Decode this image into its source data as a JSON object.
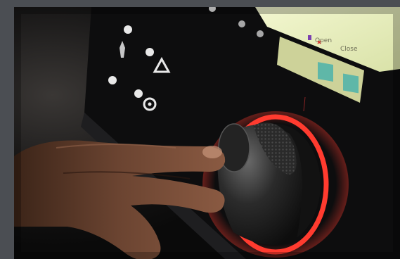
{
  "photo": {
    "subject": "hand-turning-control-knob",
    "ring_color": "#ff3b2f",
    "screen_color": "#e7edb8",
    "background_color": "#4b4e53"
  },
  "screen": {
    "tiles": [
      {
        "label": "Open",
        "icon": "open-icon"
      },
      {
        "label": "Close",
        "icon": "close-icon"
      }
    ]
  }
}
